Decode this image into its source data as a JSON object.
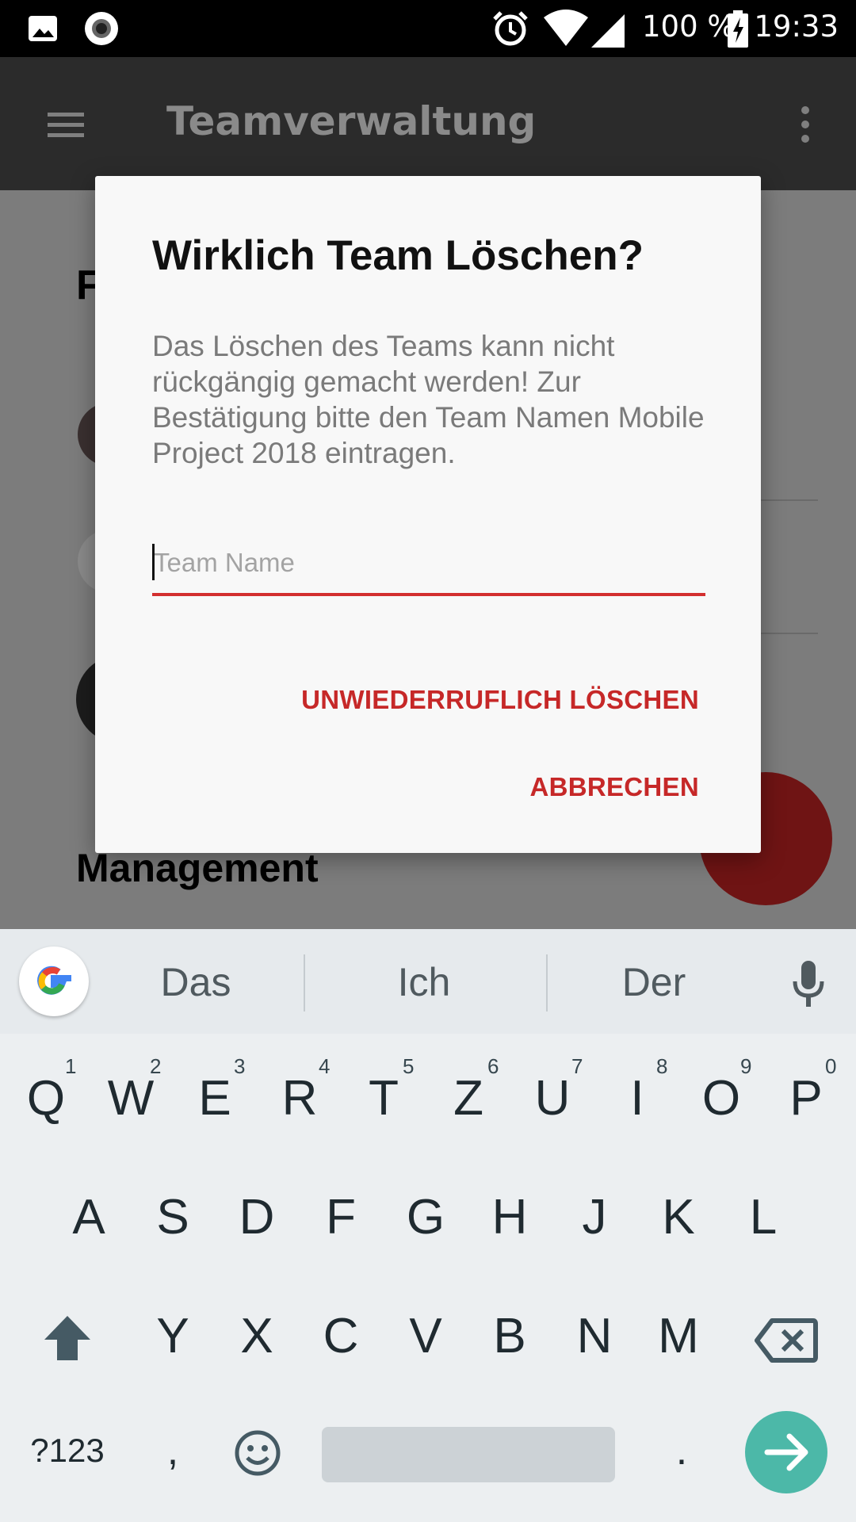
{
  "status_bar": {
    "battery_text": "100 %",
    "time": "19:33",
    "icons": [
      "image-icon",
      "record-icon",
      "alarm-icon",
      "wifi-icon",
      "signal-icon",
      "battery-charging-icon"
    ]
  },
  "app_bar": {
    "title": "Teamverwaltung",
    "menu_icon": "hamburger-menu-icon",
    "overflow_icon": "more-vert-icon"
  },
  "background": {
    "section_partial": "F",
    "section_management": "Management"
  },
  "dialog": {
    "title": "Wirklich Team Löschen?",
    "message": "Das Löschen des Teams kann nicht rückgängig gemacht werden! Zur Bestätigung bitte den Team Namen Mobile Project 2018 eintragen.",
    "input_placeholder": "Team Name",
    "input_value": "",
    "confirm_button": "UNWIEDERRUFLICH LÖSCHEN",
    "cancel_button": "ABBRECHEN",
    "accent_color": "#c62828"
  },
  "keyboard": {
    "suggestions": [
      "Das",
      "Ich",
      "Der"
    ],
    "row1": [
      "Q",
      "W",
      "E",
      "R",
      "T",
      "Z",
      "U",
      "I",
      "O",
      "P"
    ],
    "row1_hints": [
      "1",
      "2",
      "3",
      "4",
      "5",
      "6",
      "7",
      "8",
      "9",
      "0"
    ],
    "row2": [
      "A",
      "S",
      "D",
      "F",
      "G",
      "H",
      "J",
      "K",
      "L"
    ],
    "row3": [
      "Y",
      "X",
      "C",
      "V",
      "B",
      "N",
      "M"
    ],
    "symbols_key": "?123",
    "comma_key": ",",
    "period_key": ".",
    "enter_color": "#4cb8a8"
  }
}
